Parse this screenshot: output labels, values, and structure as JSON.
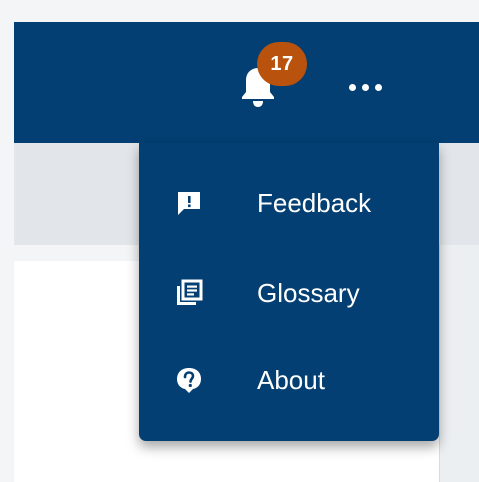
{
  "header": {
    "notifications": {
      "icon": "bell-icon",
      "count": "17"
    },
    "more_menu": {
      "icon": "more-horizontal-icon"
    }
  },
  "dropdown_menu": {
    "items": [
      {
        "label": "Feedback",
        "icon": "feedback-icon"
      },
      {
        "label": "Glossary",
        "icon": "glossary-icon"
      },
      {
        "label": "About",
        "icon": "help-icon"
      }
    ]
  },
  "colors": {
    "header_bg": "#033f72",
    "menu_bg": "#033f72",
    "badge_bg": "#b8520d",
    "subbar_bg": "#e2e6ea",
    "text": "#ffffff"
  }
}
